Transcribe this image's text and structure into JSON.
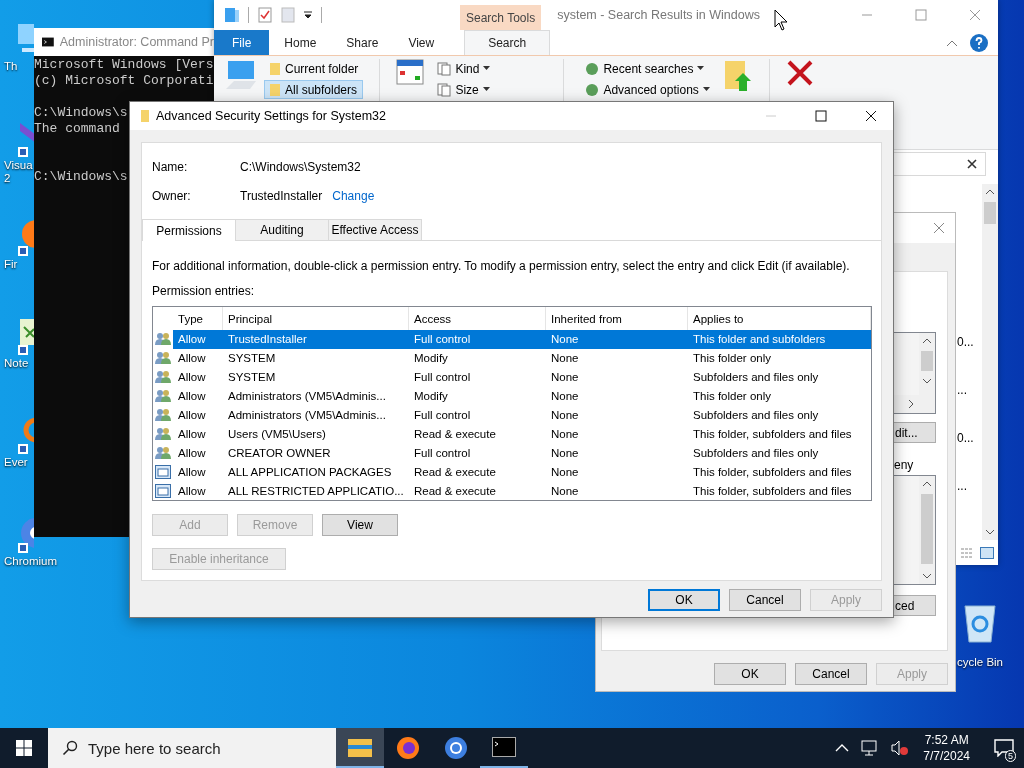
{
  "desktop": {
    "icons": [
      {
        "kind": "pc",
        "lines": [
          "Th"
        ]
      },
      {
        "kind": "vs",
        "lines": [
          "Visua",
          "2"
        ]
      },
      {
        "kind": "firefox",
        "lines": [
          "Fir"
        ]
      },
      {
        "kind": "notepad",
        "lines": [
          "Note"
        ]
      },
      {
        "kind": "everything",
        "lines": [
          "Ever"
        ]
      },
      {
        "kind": "chromium",
        "lines": [
          "Chromium"
        ]
      }
    ],
    "right_icons": [
      {
        "kind": "recycle",
        "label": "cycle Bin"
      }
    ]
  },
  "cmd": {
    "title": "Administrator: Command Pr",
    "blocks": [
      [
        "Microsoft Windows [Vers",
        "(c) Microsoft Corporati"
      ],
      [
        "C:\\Windows\\s",
        "The command"
      ],
      [
        "C:\\Windows\\s"
      ]
    ]
  },
  "explorer": {
    "title": "system - Search Results in Windows",
    "context_tab": "Search Tools",
    "tabs": [
      {
        "label": "File",
        "kind": "file",
        "selected": false
      },
      {
        "label": "Home",
        "kind": "tab",
        "selected": false
      },
      {
        "label": "Share",
        "kind": "tab",
        "selected": false
      },
      {
        "label": "View",
        "kind": "tab",
        "selected": false
      },
      {
        "label": "Search",
        "kind": "tab",
        "selected": true
      }
    ],
    "location": [
      {
        "label": "Current folder",
        "selected": false
      },
      {
        "label": "All subfolders",
        "selected": true
      }
    ],
    "refine": [
      "Kind",
      "Size"
    ],
    "options": [
      "Recent searches",
      "Advanced options"
    ],
    "results": [
      "0...",
      "...",
      "0...",
      "..."
    ]
  },
  "properties": {
    "upper_button": "dit...",
    "deny_label": "eny",
    "lower_button": "ced",
    "footer": [
      {
        "label": "OK",
        "disabled": false
      },
      {
        "label": "Cancel",
        "disabled": false
      },
      {
        "label": "Apply",
        "disabled": true
      }
    ]
  },
  "dialog": {
    "title": "Advanced Security Settings for System32",
    "name_label": "Name:",
    "name": "C:\\Windows\\System32",
    "owner_label": "Owner:",
    "owner": "TrustedInstaller",
    "change": "Change",
    "tabs": [
      {
        "label": "Permissions",
        "selected": true
      },
      {
        "label": "Auditing",
        "selected": false
      },
      {
        "label": "Effective Access",
        "selected": false
      }
    ],
    "instructions": "For additional information, double-click a permission entry. To modify a permission entry, select the entry and click Edit (if available).",
    "entries_label": "Permission entries:",
    "columns": [
      "Type",
      "Principal",
      "Access",
      "Inherited from",
      "Applies to"
    ],
    "rows": [
      {
        "kind": "user",
        "selected": true,
        "cells": [
          "Allow",
          "TrustedInstaller",
          "Full control",
          "None",
          "This folder and subfolders"
        ]
      },
      {
        "kind": "user",
        "selected": false,
        "cells": [
          "Allow",
          "SYSTEM",
          "Modify",
          "None",
          "This folder only"
        ]
      },
      {
        "kind": "user",
        "selected": false,
        "cells": [
          "Allow",
          "SYSTEM",
          "Full control",
          "None",
          "Subfolders and files only"
        ]
      },
      {
        "kind": "user",
        "selected": false,
        "cells": [
          "Allow",
          "Administrators (VM5\\Adminis...",
          "Modify",
          "None",
          "This folder only"
        ]
      },
      {
        "kind": "user",
        "selected": false,
        "cells": [
          "Allow",
          "Administrators (VM5\\Adminis...",
          "Full control",
          "None",
          "Subfolders and files only"
        ]
      },
      {
        "kind": "user",
        "selected": false,
        "cells": [
          "Allow",
          "Users (VM5\\Users)",
          "Read & execute",
          "None",
          "This folder, subfolders and files"
        ]
      },
      {
        "kind": "user",
        "selected": false,
        "cells": [
          "Allow",
          "CREATOR OWNER",
          "Full control",
          "None",
          "Subfolders and files only"
        ]
      },
      {
        "kind": "package",
        "selected": false,
        "cells": [
          "Allow",
          "ALL APPLICATION PACKAGES",
          "Read & execute",
          "None",
          "This folder, subfolders and files"
        ]
      },
      {
        "kind": "package",
        "selected": false,
        "cells": [
          "Allow",
          "ALL RESTRICTED APPLICATIO...",
          "Read & execute",
          "None",
          "This folder, subfolders and files"
        ]
      }
    ],
    "entry_buttons": [
      {
        "label": "Add",
        "disabled": true
      },
      {
        "label": "Remove",
        "disabled": true
      },
      {
        "label": "View",
        "disabled": false
      }
    ],
    "inheritance": {
      "label": "Enable inheritance",
      "disabled": true
    },
    "footer": [
      {
        "label": "OK",
        "disabled": false,
        "selected": true
      },
      {
        "label": "Cancel",
        "disabled": false,
        "selected": false
      },
      {
        "label": "Apply",
        "disabled": true,
        "selected": false
      }
    ]
  },
  "taskbar": {
    "search_placeholder": "Type here to search",
    "apps": [
      {
        "kind": "explorer",
        "selected": true,
        "running": true
      },
      {
        "kind": "firefox",
        "selected": false,
        "running": false
      },
      {
        "kind": "chromium",
        "selected": false,
        "running": false
      },
      {
        "kind": "cmd",
        "selected": false,
        "running": true
      }
    ],
    "time": "7:52 AM",
    "date": "7/7/2024",
    "notifications": "5"
  }
}
